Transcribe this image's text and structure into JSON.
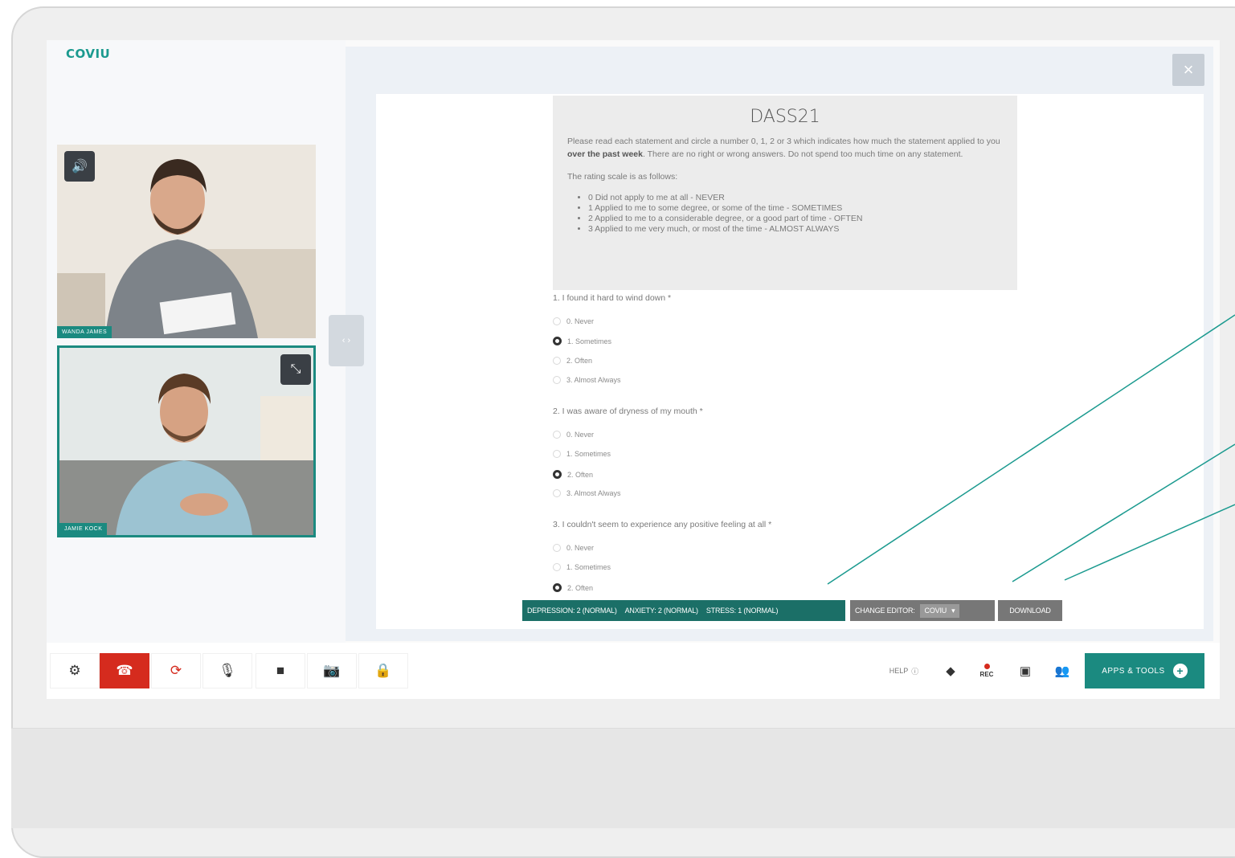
{
  "app": {
    "logo": "COVIU"
  },
  "video": {
    "participant1": {
      "name": "WANDA JAMES",
      "volume_icon": "speaker-icon"
    },
    "participant2": {
      "name": "JAMIE KOCK",
      "expand_icon": "collapse-arrows-icon"
    },
    "splitter_label": "‹ ›"
  },
  "dialog": {
    "close_label": "×"
  },
  "form": {
    "title": "DASS21",
    "intro_before": "Please read each statement and circle a number 0, 1, 2 or 3 which indicates how much the statement applied to you ",
    "intro_bold": "over the past week",
    "intro_after": ". There are no right or wrong answers. Do not spend too much time on any statement.",
    "scale_label": "The rating scale is as follows:",
    "scale": [
      "0 Did not apply to me at all - NEVER",
      "1 Applied to me to some degree, or some of the time - SOMETIMES",
      "2 Applied to me to a considerable degree, or a good part of time - OFTEN",
      "3 Applied to me very much, or most of the time - ALMOST ALWAYS"
    ],
    "questions": [
      {
        "text": "1. I found it hard to wind down *",
        "options": [
          "0. Never",
          "1. Sometimes",
          "2. Often",
          "3. Almost Always"
        ],
        "selected": 1
      },
      {
        "text": "2. I was aware of dryness of my mouth *",
        "options": [
          "0. Never",
          "1. Sometimes",
          "2. Often",
          "3. Almost Always"
        ],
        "selected": 2
      },
      {
        "text": "3. I couldn't seem to experience any positive feeling at all *",
        "options": [
          "0. Never",
          "1. Sometimes",
          "2. Often"
        ],
        "selected": 2
      }
    ]
  },
  "status": {
    "depression": "DEPRESSION: 2 (NORMAL)",
    "anxiety": "ANXIETY: 2 (NORMAL)",
    "stress": "STRESS: 1 (NORMAL)",
    "change_editor_label": "CHANGE EDITOR:",
    "editor_value": "COVIU",
    "download_label": "DOWNLOAD"
  },
  "toolbar": {
    "help_label": "HELP",
    "rec_label": "REC",
    "apps_label": "APPS & TOOLS",
    "apps_plus": "+"
  },
  "colors": {
    "accent": "#1b8a80",
    "danger": "#d52b1e",
    "dark_teal": "#1b6f67"
  }
}
